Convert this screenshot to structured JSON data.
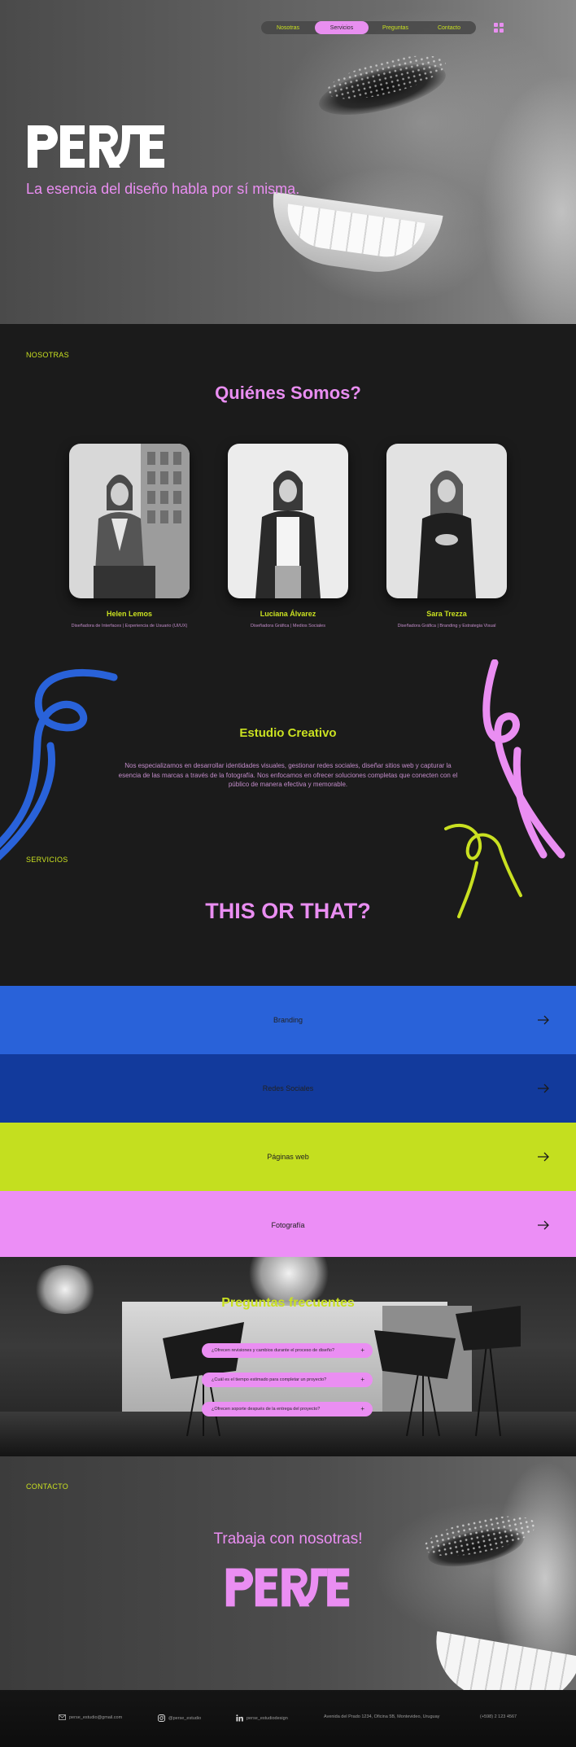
{
  "nav": {
    "items": [
      "Nosotras",
      "Servicios",
      "Preguntas",
      "Contacto"
    ],
    "active_index": 1
  },
  "hero": {
    "logo_text": "PERSE",
    "tagline": "La esencia del diseño habla por sí misma."
  },
  "about": {
    "section_label": "NOSOTRAS",
    "title": "Quiénes Somos?",
    "team": [
      {
        "name": "Helen Lemos",
        "role": "Diseñadora de Interfaces | Experiencia de Usuario (UI/UX)"
      },
      {
        "name": "Luciana Álvarez",
        "role": "Diseñadora Gráfica | Medios Sociales"
      },
      {
        "name": "Sara Trezza",
        "role": "Diseñadora Gráfica | Branding y Estrategia Visual"
      }
    ],
    "studio_title": "Estudio Creativo",
    "studio_text": "Nos especializamos en desarrollar identidades visuales, gestionar redes sociales, diseñar sitios web y capturar la esencia de las marcas a través de la fotografía. Nos enfocamos en ofrecer soluciones completas que conecten con el público de manera efectiva y memorable."
  },
  "services": {
    "section_label": "SERVICIOS",
    "title": "THIS OR THAT?",
    "items": [
      {
        "label": "Branding",
        "color": "#2962d9"
      },
      {
        "label": "Redes Sociales",
        "color": "#123a9c"
      },
      {
        "label": "Páginas web",
        "color": "#c4df1f"
      },
      {
        "label": "Fotografía",
        "color": "#ec8ef6"
      }
    ]
  },
  "faq": {
    "title": "Preguntas frecuentes",
    "questions": [
      "¿Ofrecen revisiones y cambios durante el proceso de diseño?",
      "¿Cuál es el tiempo estimado para completar un proyecto?",
      "¿Ofrecen soporte después de la entrega del proyecto?"
    ]
  },
  "contact": {
    "section_label": "CONTACTO",
    "cta": "Trabaja con nosotras!",
    "logo_text": "PERSE"
  },
  "footer": {
    "email": "perse_estudio@gmail.com",
    "instagram": "@perse_estudio",
    "linkedin": "perse_estudiodesign",
    "address": "Avenida del Prado 1234, Oficina 5B, Montevideo, Uruguay",
    "phone": "(+598) 2 123 4567"
  },
  "colors": {
    "lime": "#c9e021",
    "pink": "#ea8ef2",
    "blue": "#2962d9",
    "navy": "#123a9c",
    "background": "#1b1b1b"
  }
}
